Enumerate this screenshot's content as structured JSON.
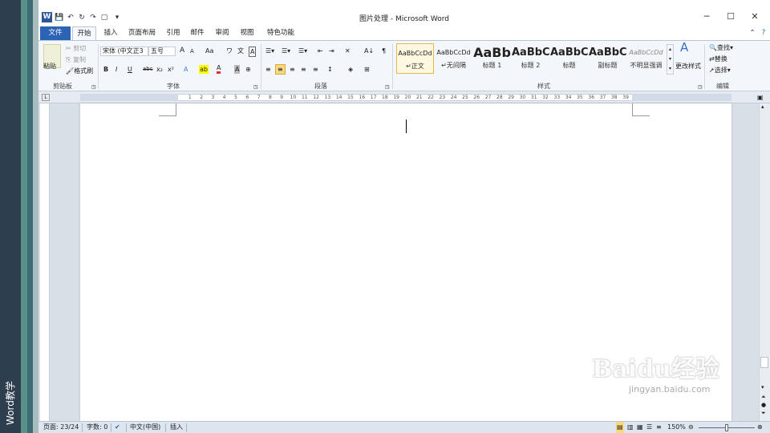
{
  "side_label": "Word教学",
  "window": {
    "title": "图片处理 - Microsoft Word",
    "app_icon": "W",
    "minimize": "─",
    "maximize": "☐",
    "close": "✕"
  },
  "quick_access": {
    "save": "💾",
    "undo": "↶",
    "redo": "↷",
    "repeat": "↻",
    "new": "▢",
    "more": "▾"
  },
  "tabs": [
    {
      "label": "文件"
    },
    {
      "label": "开始"
    },
    {
      "label": "插入"
    },
    {
      "label": "页面布局"
    },
    {
      "label": "引用"
    },
    {
      "label": "邮件"
    },
    {
      "label": "审阅"
    },
    {
      "label": "视图"
    },
    {
      "label": "特色功能"
    }
  ],
  "ribbon": {
    "clipboard": {
      "paste": "粘贴",
      "cut": "剪切",
      "copy": "复制",
      "format_painter": "格式刷",
      "label": "剪贴板"
    },
    "font": {
      "font_name": "宋体 (中文正3",
      "font_size": "五号",
      "grow": "A",
      "shrink": "A",
      "case": "Aa",
      "clear": "ワ",
      "phonetic": "文",
      "border": "A",
      "bold": "B",
      "italic": "I",
      "underline": "U",
      "strike": "abc",
      "sub": "x₂",
      "sup": "x²",
      "effect": "A",
      "highlight": "ab",
      "color": "A",
      "char_shade": "A",
      "enclose": "字",
      "label": "字体"
    },
    "paragraph": {
      "bullets": "☰",
      "numbering": "☰",
      "multilevel": "☰",
      "dec_indent": "⇤",
      "inc_indent": "⇥",
      "cn_layout": "✕",
      "sort": "A↓",
      "marks": "¶",
      "align_left": "≡",
      "center": "≡",
      "align_right": "≡",
      "justify": "≡",
      "distributed": "≡",
      "line_spacing": "↕",
      "shading": "◈",
      "borders": "⊞",
      "label": "段落"
    },
    "styles": {
      "items": [
        {
          "preview": "AaBbCcDd",
          "name": "正文",
          "prefix": "↵"
        },
        {
          "preview": "AaBbCcDd",
          "name": "无间隔",
          "prefix": "↵"
        },
        {
          "preview": "AaBb",
          "name": "标题 1",
          "prefix": ""
        },
        {
          "preview": "AaBbC",
          "name": "标题 2",
          "prefix": ""
        },
        {
          "preview": "AaBbC",
          "name": "标题",
          "prefix": ""
        },
        {
          "preview": "AaBbC",
          "name": "副标题",
          "prefix": ""
        },
        {
          "preview": "AaBbCcDd",
          "name": "不明显强调",
          "prefix": ""
        }
      ],
      "change_styles": "更改样式",
      "label": "样式"
    },
    "editing": {
      "find": "查找",
      "replace": "替换",
      "select": "选择",
      "label": "编辑"
    }
  },
  "ruler_numbers": [
    "8",
    "7",
    "6",
    "5",
    "4",
    "3",
    "2",
    "1",
    "",
    "1",
    "2",
    "3",
    "4",
    "5",
    "6",
    "7",
    "8",
    "9",
    "10",
    "11",
    "12",
    "13",
    "14",
    "15",
    "16",
    "17",
    "18",
    "19",
    "20",
    "21",
    "22",
    "23",
    "24",
    "25",
    "26",
    "27",
    "28",
    "29",
    "30",
    "31",
    "32",
    "33",
    "34",
    "35",
    "36",
    "37",
    "38",
    "39",
    "40",
    "41",
    "42",
    "43",
    "44",
    "45",
    "46",
    "47",
    "48"
  ],
  "watermark": {
    "text": "Baidu经验",
    "url": "jingyan.baidu.com"
  },
  "status": {
    "page": "页面: 23/24",
    "words": "字数: 0",
    "language": "中文(中国)",
    "mode": "插入",
    "zoom": "150%"
  },
  "colors": {
    "file_tab": "#2b63b5",
    "accent_font_color": "#e03030",
    "highlight": "#ffff00"
  }
}
